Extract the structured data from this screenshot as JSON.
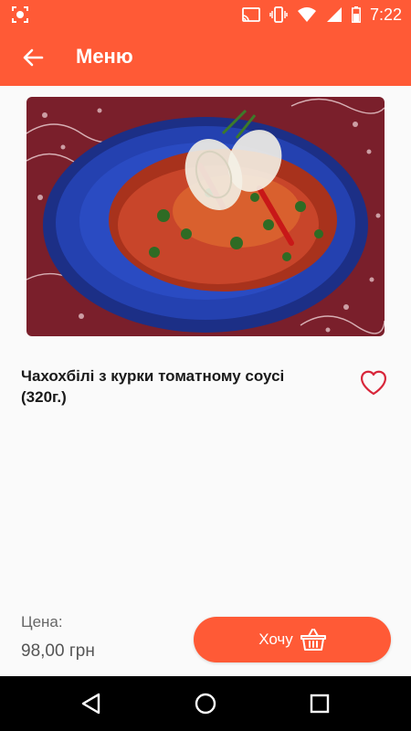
{
  "status_bar": {
    "time": "7:22"
  },
  "app_bar": {
    "title": "Меню"
  },
  "dish": {
    "name": "Чахохбілі з курки томатному соусі (320г.)"
  },
  "price": {
    "label": "Цена:",
    "value": "98,00 грн"
  },
  "order_button": {
    "label": "Хочу"
  },
  "colors": {
    "accent": "#ff5a36",
    "plate": "#1f3d9e",
    "tablecloth": "#7a1f2b"
  },
  "icons": [
    "screen-cast-icon",
    "cast-icon",
    "vibrate-icon",
    "wifi-icon",
    "signal-icon",
    "battery-icon",
    "back-arrow-icon",
    "heart-icon",
    "basket-icon",
    "nav-back-icon",
    "nav-home-icon",
    "nav-recents-icon"
  ]
}
